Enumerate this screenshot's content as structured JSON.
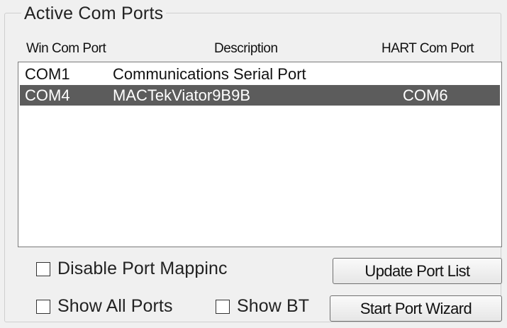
{
  "group": {
    "title": "Active Com Ports"
  },
  "columns": {
    "win_com_port": "Win Com Port",
    "description": "Description",
    "hart_com_port": "HART Com Port"
  },
  "ports": [
    {
      "port": "COM1",
      "description": "Communications Serial Port",
      "hart": ""
    },
    {
      "port": "COM4",
      "description": "MACTekViator9B9B",
      "hart": "COM6",
      "selected": true
    }
  ],
  "options": {
    "disable_port_mapping": {
      "label": "Disable Port Mappinc",
      "checked": false
    },
    "show_all_ports": {
      "label": "Show All Ports",
      "checked": false
    },
    "show_bt": {
      "label": "Show BT",
      "checked": false
    }
  },
  "buttons": {
    "update_port_list": "Update Port List",
    "start_port_wizard": "Start Port Wizard"
  },
  "colors": {
    "selection": "#5c5c5c",
    "background": "#f0f0f0"
  }
}
